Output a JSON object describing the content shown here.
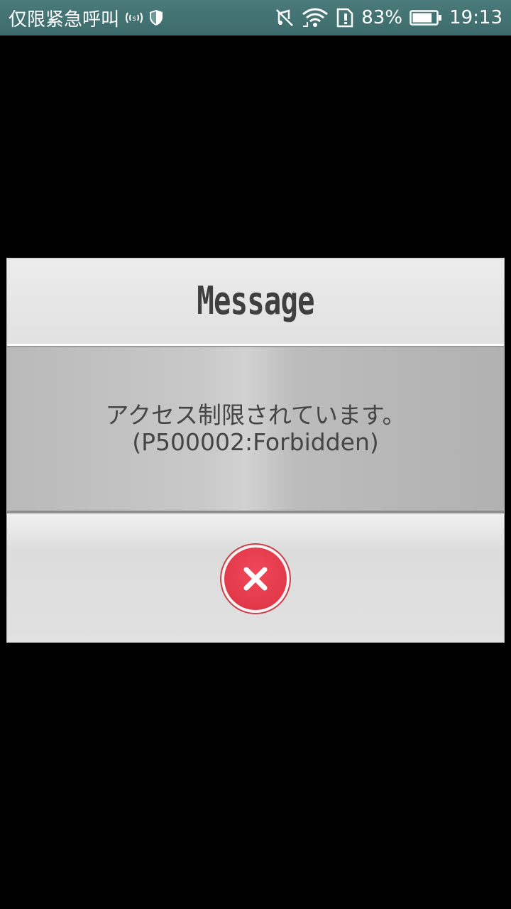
{
  "statusbar": {
    "carrier": "仅限紧急呼叫",
    "battery_percent": "83%",
    "time": "19:13",
    "battery_level": 0.83,
    "icons": [
      "emergency-signal-icon",
      "shield-icon",
      "mute-icon",
      "wifi-icon",
      "sim-alert-icon",
      "battery-icon"
    ]
  },
  "dialog": {
    "title": "Message",
    "message_line1": "アクセス制限されています。",
    "message_line2": "(P500002:Forbidden)",
    "close_icon": "close-icon"
  },
  "colors": {
    "statusbar_bg": "#3d6b6c",
    "close_red": "#e2394a",
    "text_dark": "#454545"
  }
}
